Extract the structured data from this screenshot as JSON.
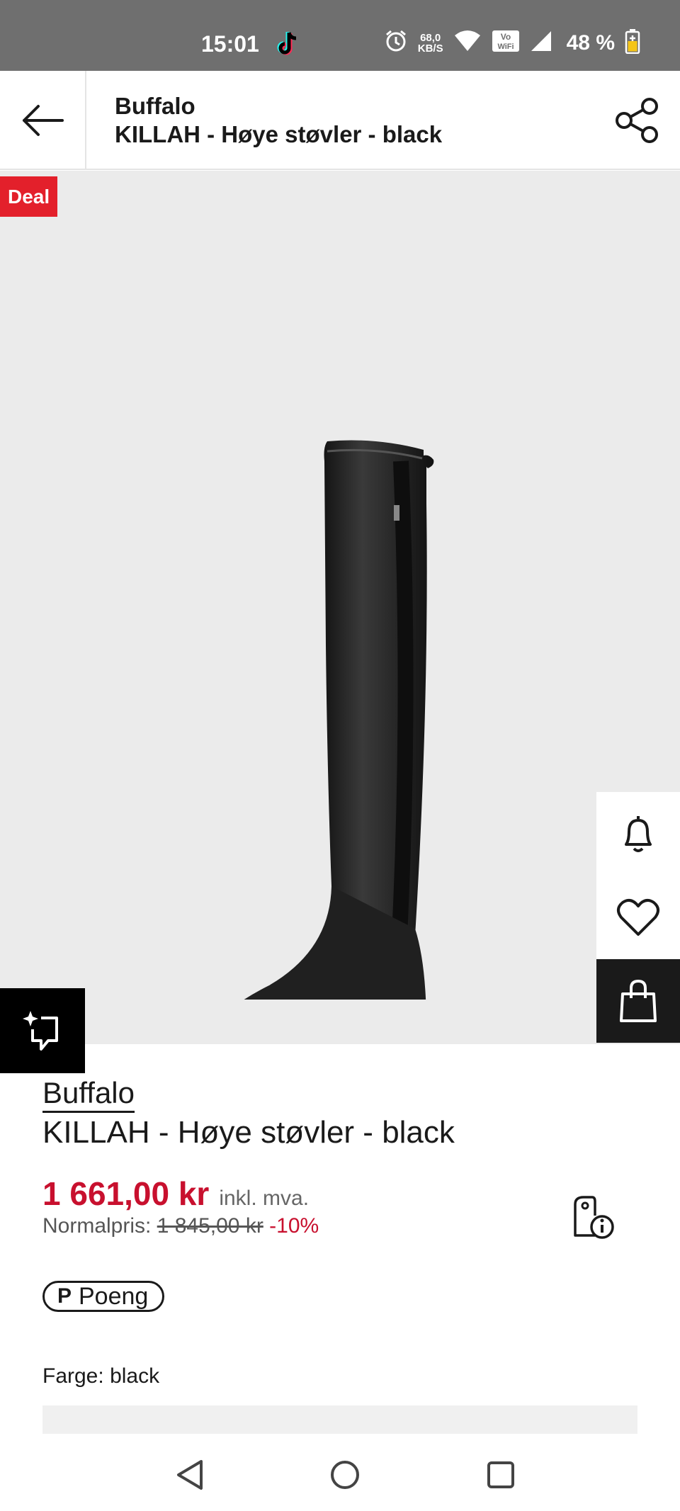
{
  "status_bar": {
    "time": "15:01",
    "net_speed_value": "68,0",
    "net_speed_unit": "KB/S",
    "wifi_badge_top": "Vo",
    "wifi_badge_bottom": "WiFi",
    "battery": "48 %",
    "icons": [
      "tiktok-icon",
      "alarm-icon",
      "wifi-icon",
      "vowifi-icon",
      "signal-icon",
      "battery-icon"
    ]
  },
  "header": {
    "brand": "Buffalo",
    "product": "KILLAH - Høye støvler - black"
  },
  "image": {
    "badge": "Deal",
    "background": "#ebebeb"
  },
  "product": {
    "brand": "Buffalo",
    "name": "KILLAH - Høye støvler - black",
    "price": "1 661,00 kr",
    "vat_note": "inkl. mva.",
    "regular_label": "Normalpris:",
    "regular_price": "1 845,00 kr",
    "discount": "-10%",
    "points_label": "Poeng",
    "points_symbol": "P",
    "colour_label": "Farge:",
    "colour_value": "black"
  },
  "colors": {
    "accent_red": "#c8102e",
    "deal_red": "#e3202b",
    "dark": "#1a1a1a"
  }
}
